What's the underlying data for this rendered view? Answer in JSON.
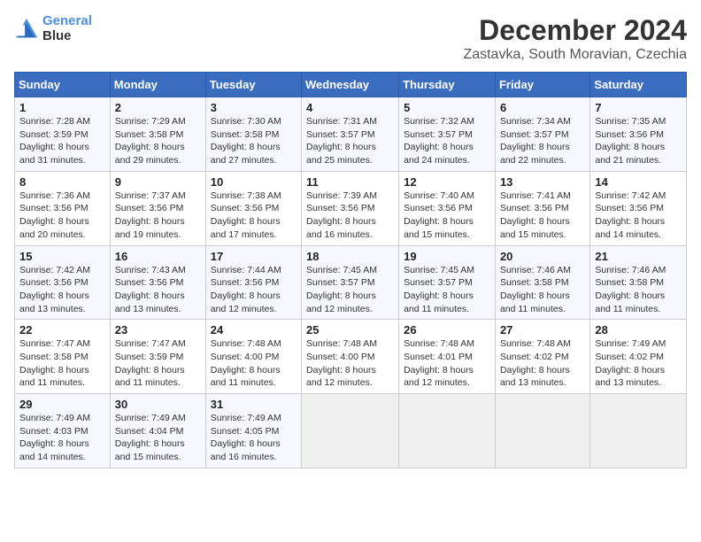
{
  "header": {
    "logo_line1": "General",
    "logo_line2": "Blue",
    "title": "December 2024",
    "subtitle": "Zastavka, South Moravian, Czechia"
  },
  "weekdays": [
    "Sunday",
    "Monday",
    "Tuesday",
    "Wednesday",
    "Thursday",
    "Friday",
    "Saturday"
  ],
  "weeks": [
    [
      {
        "day": 1,
        "info": "Sunrise: 7:28 AM\nSunset: 3:59 PM\nDaylight: 8 hours\nand 31 minutes."
      },
      {
        "day": 2,
        "info": "Sunrise: 7:29 AM\nSunset: 3:58 PM\nDaylight: 8 hours\nand 29 minutes."
      },
      {
        "day": 3,
        "info": "Sunrise: 7:30 AM\nSunset: 3:58 PM\nDaylight: 8 hours\nand 27 minutes."
      },
      {
        "day": 4,
        "info": "Sunrise: 7:31 AM\nSunset: 3:57 PM\nDaylight: 8 hours\nand 25 minutes."
      },
      {
        "day": 5,
        "info": "Sunrise: 7:32 AM\nSunset: 3:57 PM\nDaylight: 8 hours\nand 24 minutes."
      },
      {
        "day": 6,
        "info": "Sunrise: 7:34 AM\nSunset: 3:57 PM\nDaylight: 8 hours\nand 22 minutes."
      },
      {
        "day": 7,
        "info": "Sunrise: 7:35 AM\nSunset: 3:56 PM\nDaylight: 8 hours\nand 21 minutes."
      }
    ],
    [
      {
        "day": 8,
        "info": "Sunrise: 7:36 AM\nSunset: 3:56 PM\nDaylight: 8 hours\nand 20 minutes."
      },
      {
        "day": 9,
        "info": "Sunrise: 7:37 AM\nSunset: 3:56 PM\nDaylight: 8 hours\nand 19 minutes."
      },
      {
        "day": 10,
        "info": "Sunrise: 7:38 AM\nSunset: 3:56 PM\nDaylight: 8 hours\nand 17 minutes."
      },
      {
        "day": 11,
        "info": "Sunrise: 7:39 AM\nSunset: 3:56 PM\nDaylight: 8 hours\nand 16 minutes."
      },
      {
        "day": 12,
        "info": "Sunrise: 7:40 AM\nSunset: 3:56 PM\nDaylight: 8 hours\nand 15 minutes."
      },
      {
        "day": 13,
        "info": "Sunrise: 7:41 AM\nSunset: 3:56 PM\nDaylight: 8 hours\nand 15 minutes."
      },
      {
        "day": 14,
        "info": "Sunrise: 7:42 AM\nSunset: 3:56 PM\nDaylight: 8 hours\nand 14 minutes."
      }
    ],
    [
      {
        "day": 15,
        "info": "Sunrise: 7:42 AM\nSunset: 3:56 PM\nDaylight: 8 hours\nand 13 minutes."
      },
      {
        "day": 16,
        "info": "Sunrise: 7:43 AM\nSunset: 3:56 PM\nDaylight: 8 hours\nand 13 minutes."
      },
      {
        "day": 17,
        "info": "Sunrise: 7:44 AM\nSunset: 3:56 PM\nDaylight: 8 hours\nand 12 minutes."
      },
      {
        "day": 18,
        "info": "Sunrise: 7:45 AM\nSunset: 3:57 PM\nDaylight: 8 hours\nand 12 minutes."
      },
      {
        "day": 19,
        "info": "Sunrise: 7:45 AM\nSunset: 3:57 PM\nDaylight: 8 hours\nand 11 minutes."
      },
      {
        "day": 20,
        "info": "Sunrise: 7:46 AM\nSunset: 3:58 PM\nDaylight: 8 hours\nand 11 minutes."
      },
      {
        "day": 21,
        "info": "Sunrise: 7:46 AM\nSunset: 3:58 PM\nDaylight: 8 hours\nand 11 minutes."
      }
    ],
    [
      {
        "day": 22,
        "info": "Sunrise: 7:47 AM\nSunset: 3:58 PM\nDaylight: 8 hours\nand 11 minutes."
      },
      {
        "day": 23,
        "info": "Sunrise: 7:47 AM\nSunset: 3:59 PM\nDaylight: 8 hours\nand 11 minutes."
      },
      {
        "day": 24,
        "info": "Sunrise: 7:48 AM\nSunset: 4:00 PM\nDaylight: 8 hours\nand 11 minutes."
      },
      {
        "day": 25,
        "info": "Sunrise: 7:48 AM\nSunset: 4:00 PM\nDaylight: 8 hours\nand 12 minutes."
      },
      {
        "day": 26,
        "info": "Sunrise: 7:48 AM\nSunset: 4:01 PM\nDaylight: 8 hours\nand 12 minutes."
      },
      {
        "day": 27,
        "info": "Sunrise: 7:48 AM\nSunset: 4:02 PM\nDaylight: 8 hours\nand 13 minutes."
      },
      {
        "day": 28,
        "info": "Sunrise: 7:49 AM\nSunset: 4:02 PM\nDaylight: 8 hours\nand 13 minutes."
      }
    ],
    [
      {
        "day": 29,
        "info": "Sunrise: 7:49 AM\nSunset: 4:03 PM\nDaylight: 8 hours\nand 14 minutes."
      },
      {
        "day": 30,
        "info": "Sunrise: 7:49 AM\nSunset: 4:04 PM\nDaylight: 8 hours\nand 15 minutes."
      },
      {
        "day": 31,
        "info": "Sunrise: 7:49 AM\nSunset: 4:05 PM\nDaylight: 8 hours\nand 16 minutes."
      },
      {
        "day": null,
        "info": ""
      },
      {
        "day": null,
        "info": ""
      },
      {
        "day": null,
        "info": ""
      },
      {
        "day": null,
        "info": ""
      }
    ]
  ]
}
